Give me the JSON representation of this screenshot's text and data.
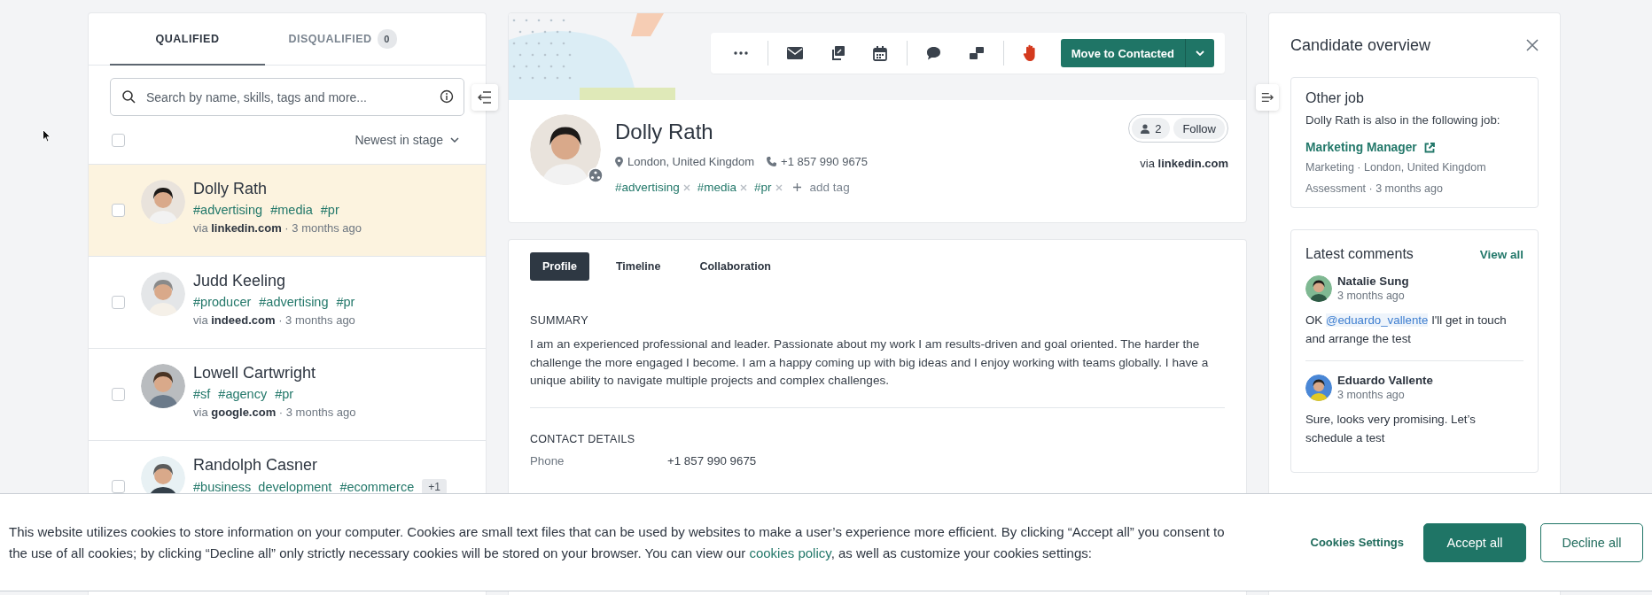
{
  "left_panel": {
    "tabs": [
      {
        "label": "QUALIFIED",
        "selected": true
      },
      {
        "label": "DISQUALIFIED",
        "count": "0",
        "selected": false
      }
    ],
    "search": {
      "placeholder": "Search by name, skills, tags and more..."
    },
    "select_all": {
      "checked": false
    },
    "sort": {
      "label": "Newest in stage"
    },
    "candidates": [
      {
        "name": "Dolly Rath",
        "tags": [
          "#advertising",
          "#media",
          "#pr"
        ],
        "via": "via",
        "source": "linkedin.com",
        "time": "· 3 months ago",
        "selected": true,
        "checked": false
      },
      {
        "name": "Judd Keeling",
        "tags": [
          "#producer",
          "#advertising",
          "#pr"
        ],
        "via": "via",
        "source": "indeed.com",
        "time": "· 3 months ago",
        "selected": false,
        "checked": false
      },
      {
        "name": "Lowell Cartwright",
        "tags": [
          "#sf",
          "#agency",
          "#pr"
        ],
        "via": "via",
        "source": "google.com",
        "time": "· 3 months ago",
        "selected": false,
        "checked": false
      },
      {
        "name": "Randolph Casner",
        "tags": [
          "#business_development",
          "#ecommerce"
        ],
        "more": "+1",
        "selected": false,
        "checked": false
      }
    ]
  },
  "toolbar": {
    "primary_action": "Move to Contacted"
  },
  "profile": {
    "name": "Dolly Rath",
    "location": "London, United Kingdom",
    "phone": "+1 857 990 9675",
    "tags": [
      "#advertising",
      "#media",
      "#pr"
    ],
    "add_tag": "add tag",
    "followers": "2",
    "follow": "Follow",
    "via": "via",
    "source": "linkedin.com"
  },
  "profile_tabs": [
    {
      "label": "Profile",
      "selected": true
    },
    {
      "label": "Timeline",
      "selected": false
    },
    {
      "label": "Collaboration",
      "selected": false
    }
  ],
  "summary": {
    "heading": "SUMMARY",
    "text": "I am an experienced professional and leader. Passionate about my work I am results-driven and goal oriented. The harder the challenge the more engaged I become. I am a happy coming up with big ideas and I enjoy working with teams globally. I have a unique ability to navigate multiple projects and complex challenges."
  },
  "contact_details": {
    "heading": "CONTACT DETAILS",
    "rows": [
      {
        "label": "Phone",
        "value": "+1 857 990 9675"
      }
    ]
  },
  "overview": {
    "title": "Candidate overview",
    "other_job": {
      "heading": "Other job",
      "intro": "Dolly Rath is also in the following job:",
      "job_title": "Marketing Manager",
      "meta": "Marketing · London, United Kingdom",
      "stage": "Assessment · 3 months ago"
    },
    "comments": {
      "heading": "Latest comments",
      "view_all": "View all",
      "items": [
        {
          "author": "Natalie Sung",
          "time": "3 months ago",
          "text_before": "OK ",
          "mention": "@eduardo_vallente",
          "text_after": " I'll get in touch and arrange the test"
        },
        {
          "author": "Eduardo Vallente",
          "time": "3 months ago",
          "text_before": "Sure, looks very promising. Let’s schedule a test"
        }
      ]
    }
  },
  "cookie_banner": {
    "text_before": "This website utilizes cookies to store information on your computer. Cookies are small text files that can be used by websites to make a user’s experience more efficient. By clicking “Accept all” you consent to the use of all cookies; by clicking “Decline all” only strictly necessary cookies will be stored on your browser. You can view our ",
    "link": "cookies policy",
    "text_after": ", as well as customize your cookies settings:",
    "settings": "Cookies Settings",
    "accept": "Accept all",
    "decline": "Decline all"
  }
}
